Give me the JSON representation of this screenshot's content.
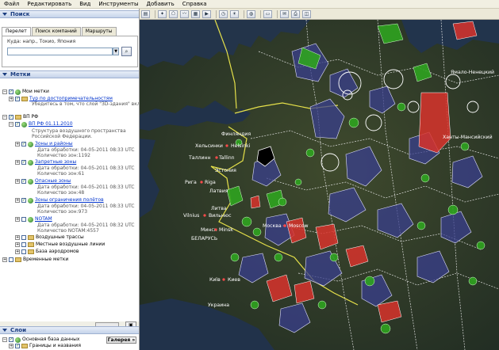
{
  "menu": [
    "Файл",
    "Редактировать",
    "Вид",
    "Инструменты",
    "Добавить",
    "Справка"
  ],
  "search": {
    "title": "Поиск",
    "tabs": [
      "Перелет",
      "Поиск компаний",
      "Маршруты"
    ],
    "label": "Куда: напр., Токио, Япония",
    "value": ""
  },
  "places": {
    "title": "Метки",
    "my_places": "Мои метки",
    "tour": "Тур по достопримечательностям",
    "tour_note": "Убедитесь в том, что слой \"3D-здания\" включен",
    "vp_rf": "ВП РФ",
    "vp_rf_date": "ВП РФ 01.11.2010",
    "structure_1": "Структура воздушного пространства",
    "structure_2": "Российской Федерации.",
    "zones": "Зоны и районы",
    "zones_date": "Дата обработки: 04-05-2011 08:33 UTC",
    "zones_count": "Количество зон:1192",
    "forbidden": "Запретные зоны",
    "forbidden_date": "Дата обработки: 04-05-2011 08:33 UTC",
    "forbidden_count": "Количество зон:61",
    "dangerous": "Опасные зоны",
    "dangerous_date": "Дата обработки: 04-05-2011 08:33 UTC",
    "dangerous_count": "Количество зон:48",
    "restricted": "Зоны ограничения полётов",
    "restricted_date": "Дата обработки: 04-05-2011 08:33 UTC",
    "restricted_count": "Количество зон:973",
    "notam": "NOTAM",
    "notam_date": "Дата обработки: 04-05-2011 08:32 UTC",
    "notam_count": "Количество NOTAM:4557",
    "airways": "Воздушные трассы",
    "local_lines": "Местные воздушные линии",
    "aerodromes": "База аэродромов",
    "temp": "Временные метки"
  },
  "layers": {
    "title": "Слои",
    "gallery": "Галерея",
    "gallery_arrow": "»",
    "base": "Основная база данных",
    "borders": "Границы и названия"
  },
  "map_labels": {
    "finland": "Финляндия",
    "helsinki": "Хельсинки",
    "helsinki_en": "Helsinki",
    "tallinn": "Таллинн",
    "tallinn_en": "Tallinn",
    "estonia": "Эстония",
    "riga": "Рига",
    "riga_en": "Riga",
    "latvia": "Латвия",
    "lithuania": "Литва",
    "vilnius": "Vilnius",
    "vilnius_ru": "Вильнюс",
    "minsk": "Минск",
    "minsk_en": "Minsk",
    "belarus": "БЕЛАРУСЬ",
    "moscow": "Москва",
    "moscow_en": "Moscow",
    "kyiv": "Київ",
    "kyiv_ru": "Киев",
    "ukraine": "Украина",
    "khanty": "Ханты-Мансийский",
    "yamalo": "Ямало-Ненецкий"
  },
  "colors": {
    "forbidden": "#d8322c",
    "dangerous": "#2fa31f",
    "restricted": "#3a3f8e",
    "menu_bg": "#f1efe2",
    "panel_header": "#c5d3ea"
  }
}
